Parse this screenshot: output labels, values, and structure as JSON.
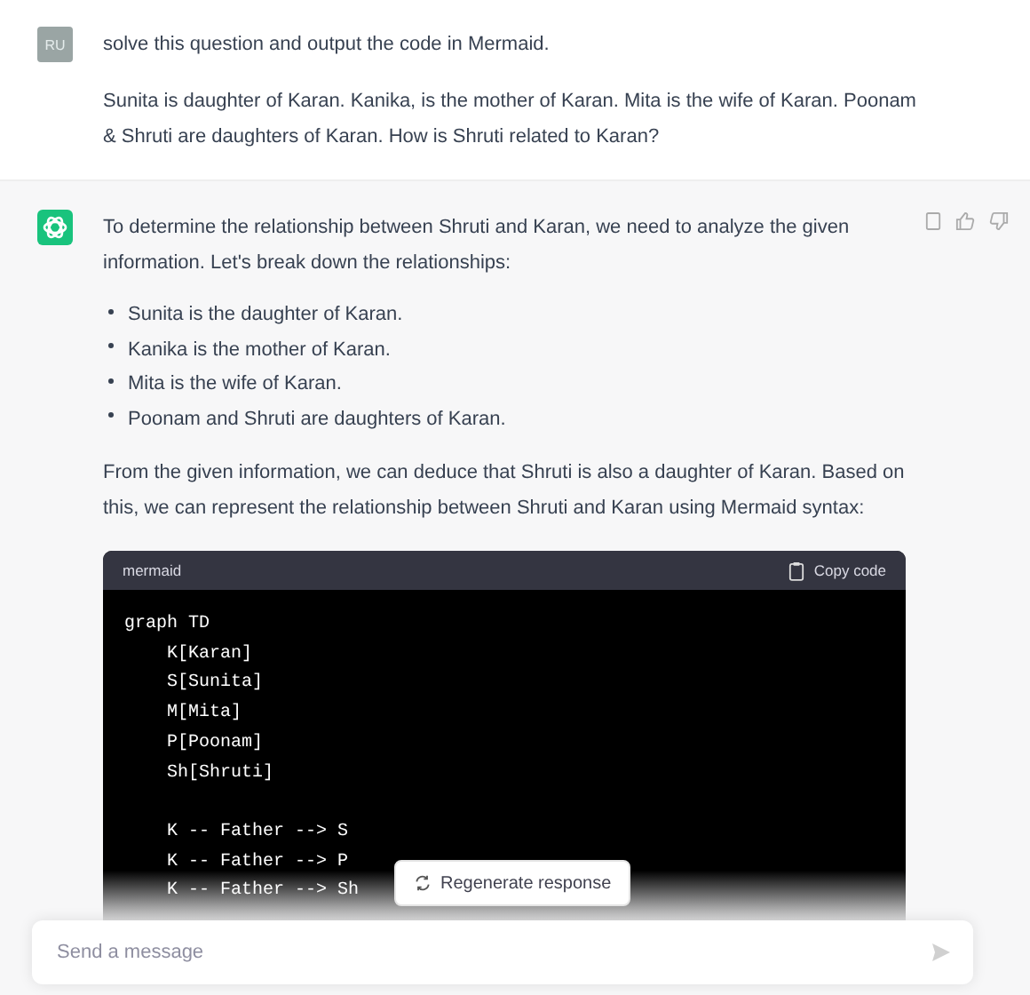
{
  "user_message": {
    "avatar": "RU",
    "paragraphs": [
      "solve this question and output the code in Mermaid.",
      "Sunita is daughter of Karan. Kanika, is the mother of Karan. Mita is the wife of Karan. Poonam & Shruti are daughters of Karan. How is Shruti related to Karan?"
    ]
  },
  "assistant_message": {
    "intro": "To determine the relationship between Shruti and Karan, we need to analyze the given information. Let's break down the relationships:",
    "bullets": [
      "Sunita is the daughter of Karan.",
      "Kanika is the mother of Karan.",
      "Mita is the wife of Karan.",
      "Poonam and Shruti are daughters of Karan."
    ],
    "conclusion": "From the given information, we can deduce that Shruti is also a daughter of Karan. Based on this, we can represent the relationship between Shruti and Karan using Mermaid syntax:",
    "code_block": {
      "language": "mermaid",
      "copy_label": "Copy code",
      "code": "graph TD\n    K[Karan]\n    S[Sunita]\n    M[Mita]\n    P[Poonam]\n    Sh[Shruti]\n\n    K -- Father --> S\n    K -- Father --> P\n    K -- Father --> Sh"
    }
  },
  "regenerate_button": "Regenerate response",
  "composer": {
    "placeholder": "Send a message"
  }
}
